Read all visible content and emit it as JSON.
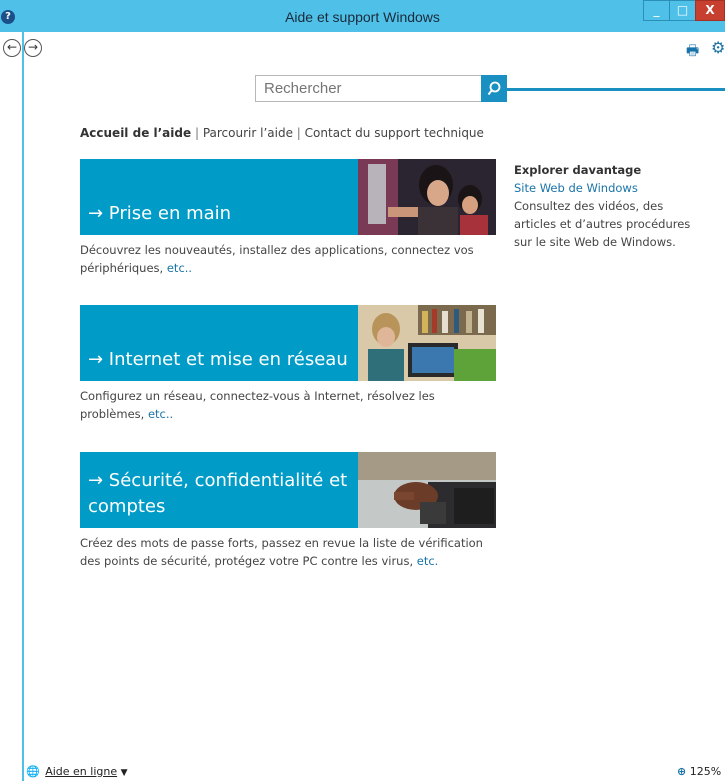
{
  "window": {
    "title": "Aide et support Windows",
    "help_glyph": "?",
    "minimize": "_",
    "maximize": "□",
    "close": "X"
  },
  "toolbar": {
    "back": "←",
    "forward": "→",
    "print": "🖶",
    "settings": "⚙"
  },
  "search": {
    "placeholder": "Rechercher",
    "button_glyph": "⌕"
  },
  "breadcrumbs": {
    "home": "Accueil de l’aide",
    "browse": "Parcourir l’aide",
    "contact": "Contact du support technique",
    "separator": "|"
  },
  "tiles": [
    {
      "label": "→ Prise en main",
      "description": "Découvrez les nouveautés, installez des applications, connectez vos périphériques,",
      "link": "etc.."
    },
    {
      "label": "→ Internet et mise en réseau",
      "description": "Configurez un réseau, connectez-vous à Internet, résolvez les problèmes,",
      "link": "etc.."
    },
    {
      "label": "→ Sécurité, confidentialité et comptes",
      "description": "Créez des mots de passe forts, passez en revue la liste de vérification des points de sécurité, protégez votre PC contre les virus,",
      "link": "etc."
    }
  ],
  "sidebar": {
    "title": "Explorer davantage",
    "link": "Site Web de Windows",
    "text": "Consultez des vidéos, des articles et d’autres procédures sur le site Web de Windows."
  },
  "status": {
    "online_help": "Aide en ligne",
    "dropdown": "▼",
    "zoom": "125%"
  },
  "colors": {
    "titlebar": "#4fc1e9",
    "tile": "#009cc7",
    "link": "#1a73a8",
    "close": "#c7402f"
  }
}
